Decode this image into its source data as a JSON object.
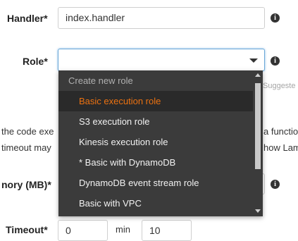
{
  "handler": {
    "label": "Handler*",
    "value": "index.handler",
    "info_icon": "info-icon"
  },
  "role": {
    "label": "Role*",
    "value": "",
    "caret_icon": "caret-down-icon",
    "info_icon": "info-icon"
  },
  "role_dropdown": {
    "group_label": "Create new role",
    "options": [
      {
        "label": "Basic execution role",
        "selected": true
      },
      {
        "label": "S3 execution role",
        "selected": false
      },
      {
        "label": "Kinesis execution role",
        "selected": false
      },
      {
        "label": "* Basic with DynamoDB",
        "selected": false
      },
      {
        "label": "DynamoDB event stream role",
        "selected": false
      },
      {
        "label": "Basic with VPC",
        "selected": false
      }
    ],
    "selected_color": "#ec7211"
  },
  "background": {
    "hint_partial": "Suggeste",
    "text_line1_left": "the code exe",
    "text_line1_right": "a functio",
    "text_line2_left": "timeout may",
    "text_line2_right": "how Lam",
    "memory_label_partial": "nory (MB)*",
    "timeout_label_partial": "Timeout*",
    "timeout_value_partial": "0",
    "timeout_unit_partial": "min",
    "timeout_seconds_partial": "10"
  }
}
